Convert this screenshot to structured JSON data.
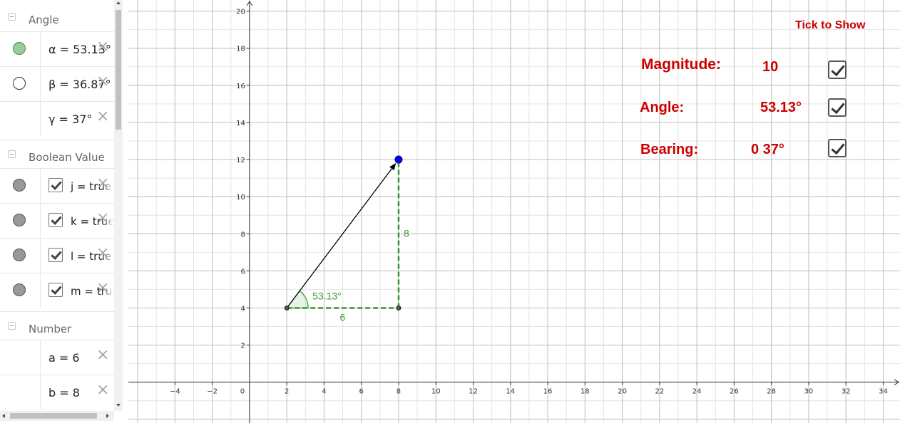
{
  "algebra": {
    "groups": [
      {
        "label": "Angle"
      },
      {
        "label": "Boolean Value"
      },
      {
        "label": "Number"
      }
    ],
    "angle_items": [
      {
        "expr": "α = 53.13°",
        "marble": "#99cc99"
      },
      {
        "expr": "β = 36.87°",
        "marble": "#ffffff"
      },
      {
        "expr": "γ = 37°"
      }
    ],
    "boolean_items": [
      {
        "expr": "j = true"
      },
      {
        "expr": "k = true"
      },
      {
        "expr": "l = true"
      },
      {
        "expr": "m = true"
      }
    ],
    "number_items": [
      {
        "expr": "a = 6"
      },
      {
        "expr": "b = 8"
      }
    ],
    "delete_glyph": "×"
  },
  "graph": {
    "x_ticks": [
      "−4",
      "−2",
      "0",
      "2",
      "4",
      "6",
      "8",
      "10",
      "12",
      "14",
      "16",
      "18",
      "20",
      "22",
      "24",
      "26",
      "28",
      "30",
      "32",
      "34"
    ],
    "y_ticks": [
      "2",
      "4",
      "6",
      "8",
      "10",
      "12",
      "14",
      "16",
      "18",
      "20"
    ],
    "x_range": [
      -6.5,
      34.9
    ],
    "y_range": [
      -2.2,
      20.6
    ],
    "vector": {
      "from": [
        2,
        4
      ],
      "to": [
        8,
        12
      ]
    },
    "right_angle_corner": [
      8,
      4
    ],
    "side_labels": {
      "horizontal": "6",
      "vertical": "8"
    },
    "angle_label": "53.13°",
    "colors": {
      "vector": "#000000",
      "legs": "#339933",
      "point": "#0000ff",
      "grid": "#c0c0c0"
    }
  },
  "panel": {
    "title": "Tick to Show",
    "magnitude_label": "Magnitude:",
    "magnitude_value": "10",
    "angle_label": "Angle:",
    "angle_value": "53.13°",
    "bearing_label": "Bearing:",
    "bearing_value": "0 37°",
    "accent": "#cc0000"
  }
}
